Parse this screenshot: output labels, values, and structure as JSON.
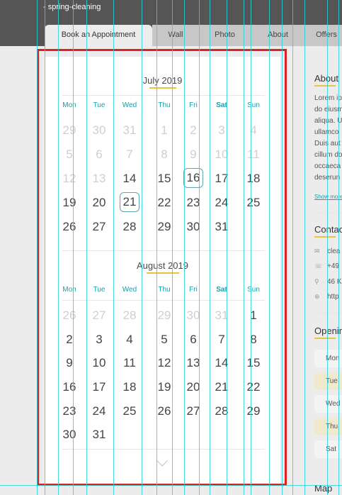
{
  "header": {
    "subtitle": "- spring-cleaning",
    "tabs": [
      "Book an Appointment",
      "Wall",
      "Photo",
      "About",
      "Offers"
    ]
  },
  "calendar": {
    "months": [
      {
        "title": "July 2019",
        "dows": [
          "Mon",
          "Tue",
          "Wed",
          "Thu",
          "Fri",
          "Sat",
          "Sun"
        ],
        "rows": [
          [
            "29",
            "30",
            "31",
            "1",
            "2",
            "3",
            "4"
          ],
          [
            "5",
            "6",
            "7",
            "8",
            "9",
            "10",
            "11"
          ],
          [
            "12",
            "13",
            "14",
            "15",
            "16",
            "17",
            "18"
          ],
          [
            "19",
            "20",
            "21",
            "22",
            "23",
            "24",
            "25"
          ],
          [
            "26",
            "27",
            "28",
            "29",
            "30",
            "31",
            ""
          ]
        ],
        "dimmed_count": 16,
        "selected": [
          "16",
          "21"
        ]
      },
      {
        "title": "August 2019",
        "dows": [
          "Mon",
          "Tue",
          "Wed",
          "Thu",
          "Fri",
          "Sat",
          "Sun"
        ],
        "rows": [
          [
            "26",
            "27",
            "28",
            "29",
            "30",
            "31",
            "1"
          ],
          [
            "2",
            "3",
            "4",
            "5",
            "6",
            "7",
            "8"
          ],
          [
            "9",
            "10",
            "11",
            "12",
            "13",
            "14",
            "15"
          ],
          [
            "16",
            "17",
            "18",
            "19",
            "20",
            "21",
            "22"
          ],
          [
            "23",
            "24",
            "25",
            "26",
            "27",
            "28",
            "29"
          ],
          [
            "30",
            "31",
            "",
            "",
            "",
            "",
            ""
          ]
        ],
        "dimmed_count": 6
      }
    ],
    "scroll_icon": "chevron-down-icon"
  },
  "sidebar": {
    "about_heading": "About",
    "about_text": [
      "Lorem ip",
      "do eiusm",
      "aliqua. U",
      "ullamco",
      "Duis aut",
      "cillum do",
      "occaeca",
      "deserun"
    ],
    "show_more": "Show more",
    "contact_heading": "Contac",
    "contacts": [
      {
        "icon": "mail-icon",
        "text": "clea"
      },
      {
        "icon": "phone-icon",
        "text": "+49"
      },
      {
        "icon": "location-icon",
        "text": "46 K"
      },
      {
        "icon": "globe-icon",
        "text": "http"
      }
    ],
    "opening_heading": "Openin",
    "hours": [
      "Mon",
      "Tue",
      "Wed",
      "Thu",
      "Sat"
    ],
    "map_heading": "Map"
  },
  "colors": {
    "accent": "#1a9ea8",
    "underline": "#e8c440",
    "highlight": "#e02020",
    "guide": "#29d2dc"
  }
}
